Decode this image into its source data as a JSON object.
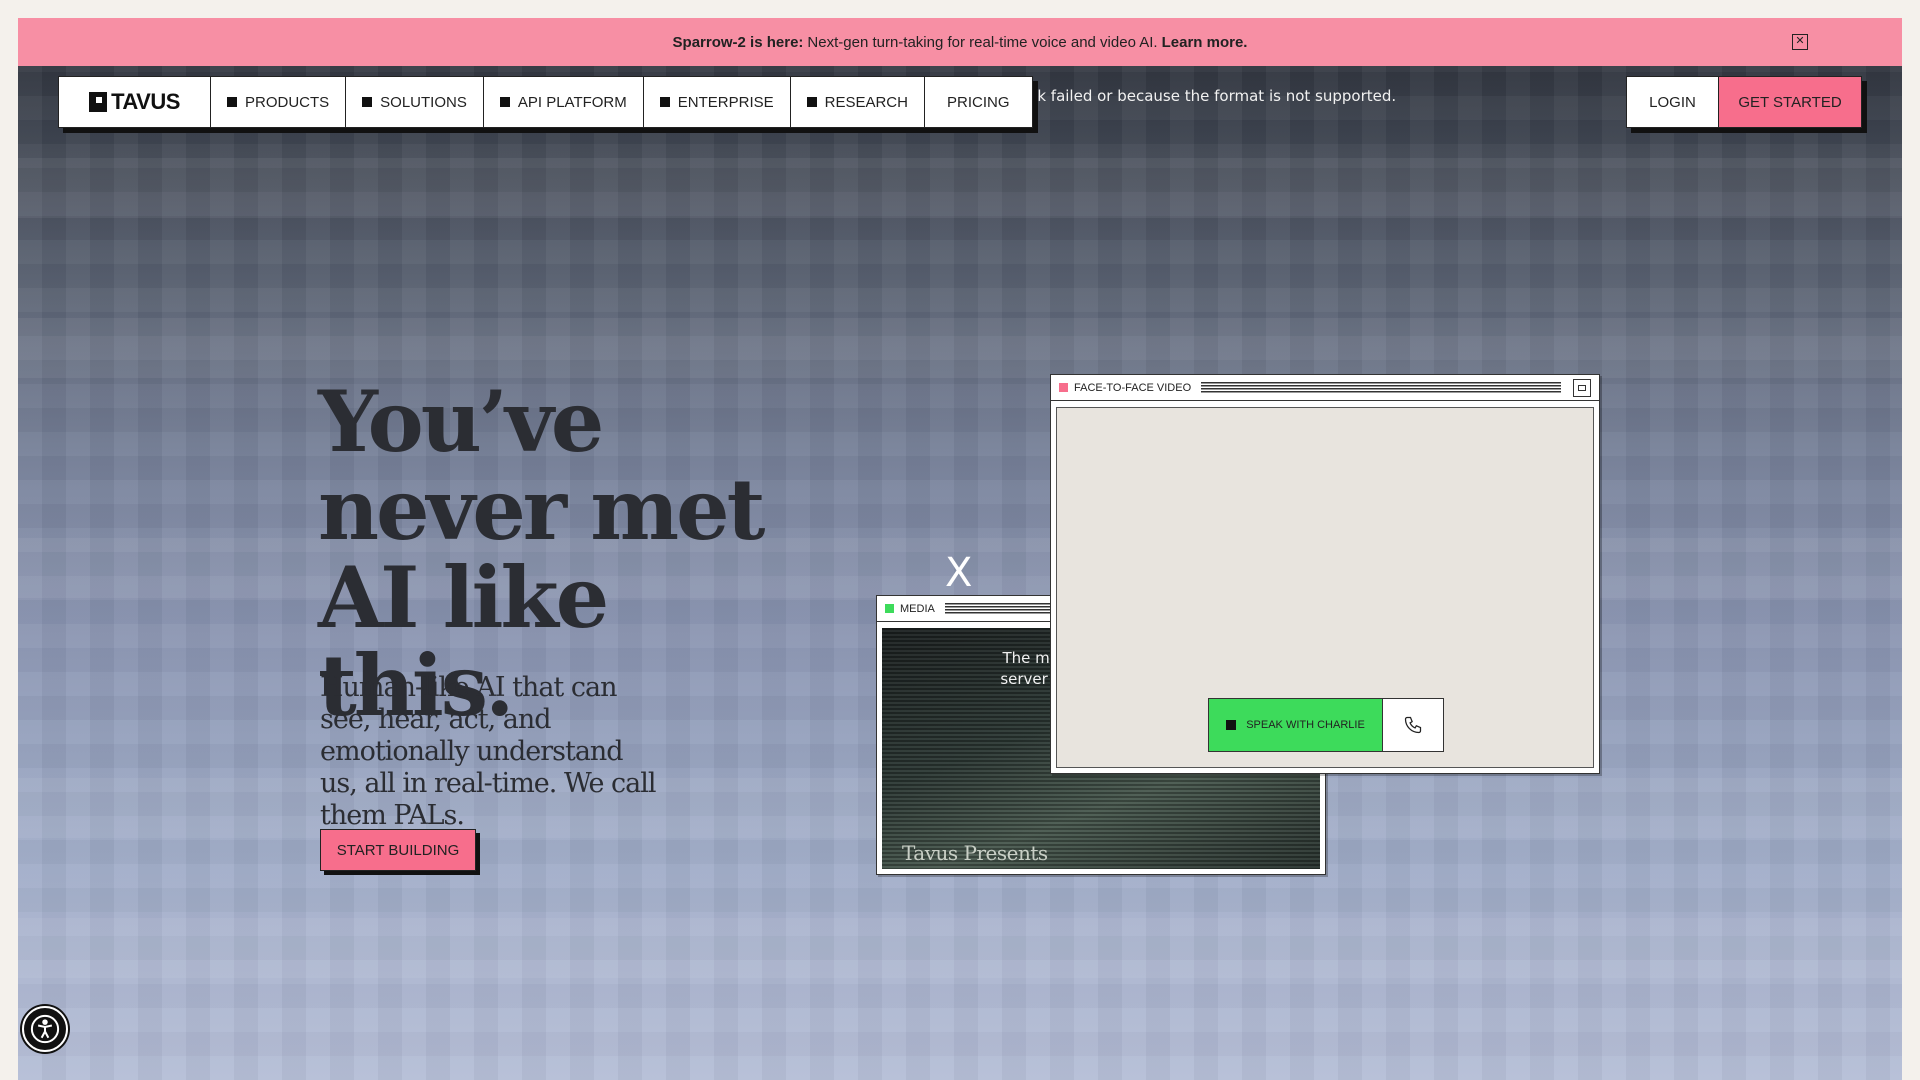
{
  "announcement": {
    "headline": "Sparrow-2 is here:",
    "message": "Next-gen turn-taking for real-time voice and video AI.",
    "link": "Learn more.",
    "close_icon": "close-icon"
  },
  "nav": {
    "logo": "TAVUS",
    "items": [
      {
        "label": "PRODUCTS",
        "has_square": true
      },
      {
        "label": "SOLUTIONS",
        "has_square": true
      },
      {
        "label": "API PLATFORM",
        "has_square": true
      },
      {
        "label": "ENTERPRISE",
        "has_square": true
      },
      {
        "label": "RESEARCH",
        "has_square": true
      },
      {
        "label": "PRICING",
        "has_square": false
      }
    ],
    "login": "LOGIN",
    "get_started": "GET STARTED"
  },
  "media_error_top": "or network failed or because the format is not supported.",
  "hero": {
    "title_line1": "You’ve",
    "title_line2": "never met",
    "title_line3": "AI like this.",
    "subtitle": "Human-like AI that can see, hear, act, and emotionally understand us, all in real-time. We call them PALs.",
    "cta": "START BUILDING"
  },
  "media_window": {
    "title": "MEDIA",
    "error_line1": "The media could n",
    "error_line2": "server or network f",
    "caption": "Tavus Presents",
    "close_mark": "X"
  },
  "f2f_window": {
    "title": "FACE-TO-FACE VIDEO",
    "speak_button": "SPEAK WITH CHARLIE",
    "phone_icon": "phone-icon"
  },
  "colors": {
    "announcement_bg": "#f78fa4",
    "accent_pink": "#f76e8c",
    "speak_green": "#3ddb5b",
    "media_dot": "#3ddb5b",
    "f2f_dot": "#f76e8c"
  }
}
